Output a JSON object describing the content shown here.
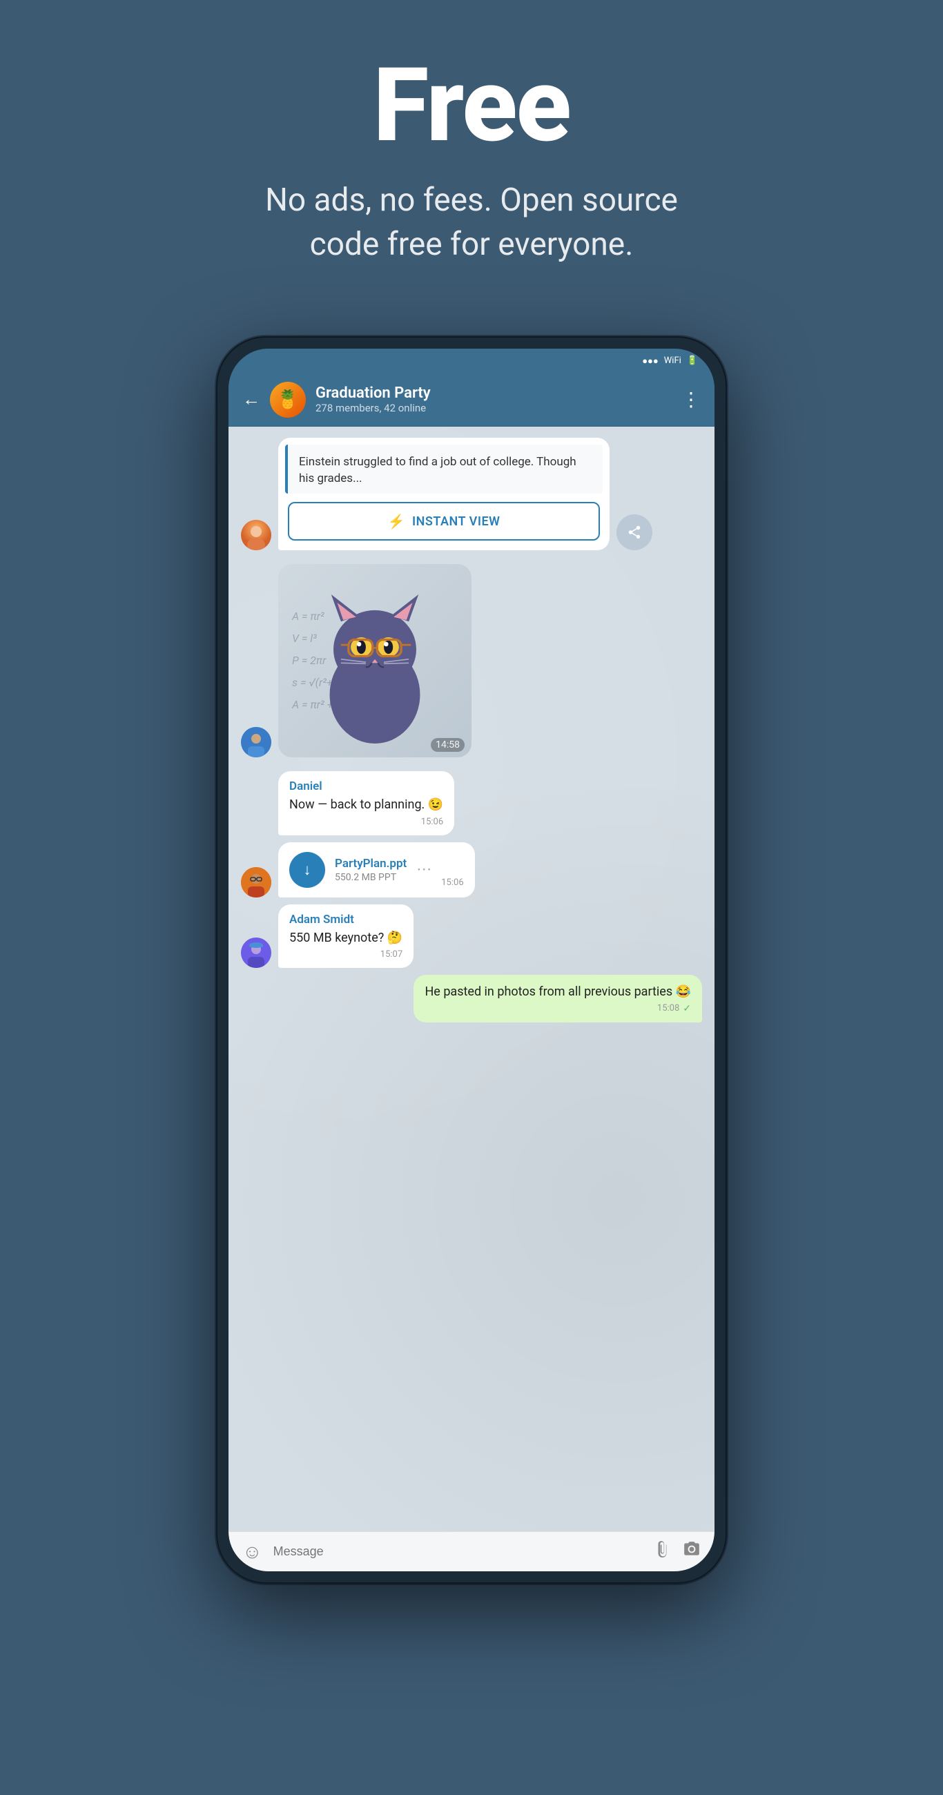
{
  "hero": {
    "title": "Free",
    "subtitle": "No ads, no fees. Open source code free for everyone."
  },
  "phone": {
    "header": {
      "group_name": "Graduation Party",
      "members": "278 members, 42 online",
      "back_label": "←",
      "more_label": "⋮"
    },
    "messages": [
      {
        "id": "article-msg",
        "type": "article",
        "avatar": "female",
        "article_text": "Einstein struggled to find a job out of college. Though his grades...",
        "instant_view_label": "INSTANT VIEW",
        "bolt": "⚡"
      },
      {
        "id": "sticker-msg",
        "type": "sticker",
        "avatar": "male1",
        "time": "14:58"
      },
      {
        "id": "daniel-msg",
        "type": "text",
        "sender": "Daniel",
        "text": "Now — back to planning. 😉",
        "time": "15:06",
        "avatar": "none"
      },
      {
        "id": "file-msg",
        "type": "file",
        "avatar": "male2",
        "file_name": "PartyPlan.ppt",
        "file_size": "550.2 MB PPT",
        "time": "15:06"
      },
      {
        "id": "adam-msg",
        "type": "text",
        "sender": "Adam Smidt",
        "text": "550 MB keynote? 🤔",
        "time": "15:07",
        "avatar": "male3"
      },
      {
        "id": "outgoing-msg",
        "type": "outgoing",
        "text": "He pasted in photos from all previous parties 😂",
        "time": "15:08",
        "checkmark": "✓"
      }
    ],
    "input_bar": {
      "placeholder": "Message",
      "emoji_icon": "☺",
      "attach_icon": "📎",
      "camera_icon": "⬤"
    }
  }
}
